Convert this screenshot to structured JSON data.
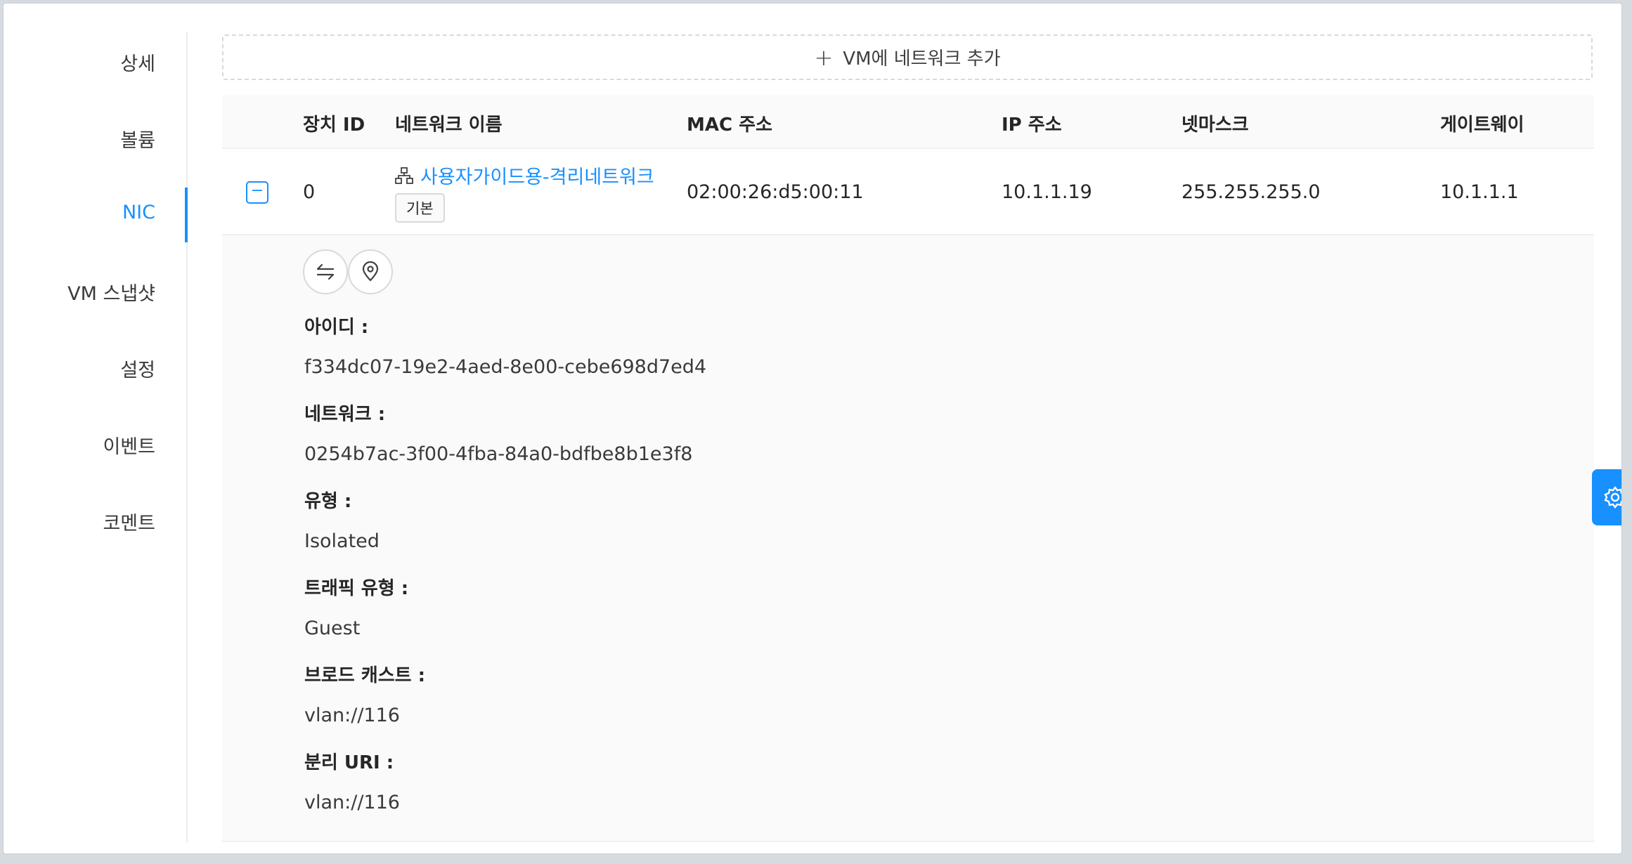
{
  "sidebar": {
    "tabs": [
      {
        "label": "상세"
      },
      {
        "label": "볼륨"
      },
      {
        "label": "NIC"
      },
      {
        "label": "VM 스냅샷"
      },
      {
        "label": "설정"
      },
      {
        "label": "이벤트"
      },
      {
        "label": "코멘트"
      }
    ],
    "active": "NIC"
  },
  "add_network": {
    "icon": "plus-icon",
    "label": "VM에 네트워크 추가"
  },
  "table": {
    "headers": {
      "device_id": "장치 ID",
      "network_name": "네트워크 이름",
      "mac": "MAC 주소",
      "ip": "IP 주소",
      "netmask": "넷마스크",
      "gateway": "게이트웨이"
    },
    "rows": [
      {
        "expand_icon": "collapse-minus-icon",
        "device_id": "0",
        "network_icon": "network-topology-icon",
        "network_name": "사용자가이드용-격리네트워크",
        "tag": "기본",
        "mac": "02:00:26:d5:00:11",
        "ip": "10.1.1.19",
        "netmask": "255.255.255.0",
        "gateway": "10.1.1.1"
      }
    ]
  },
  "detail": {
    "actions": [
      {
        "icon": "swap-arrows-icon"
      },
      {
        "icon": "location-pin-icon"
      }
    ],
    "fields": [
      {
        "label": "아이디 :",
        "value": "f334dc07-19e2-4aed-8e00-cebe698d7ed4"
      },
      {
        "label": "네트워크 :",
        "value": "0254b7ac-3f00-4fba-84a0-bdfbe8b1e3f8"
      },
      {
        "label": "유형 :",
        "value": "Isolated"
      },
      {
        "label": "트래픽 유형 :",
        "value": "Guest"
      },
      {
        "label": "브로드 캐스트 :",
        "value": "vlan://116"
      },
      {
        "label": "분리 URI :",
        "value": "vlan://116"
      }
    ]
  },
  "settings_button": {
    "icon": "gear-icon"
  },
  "colors": {
    "accent": "#1890ff",
    "header_bg": "#fafafa",
    "border": "#d9d9d9"
  }
}
